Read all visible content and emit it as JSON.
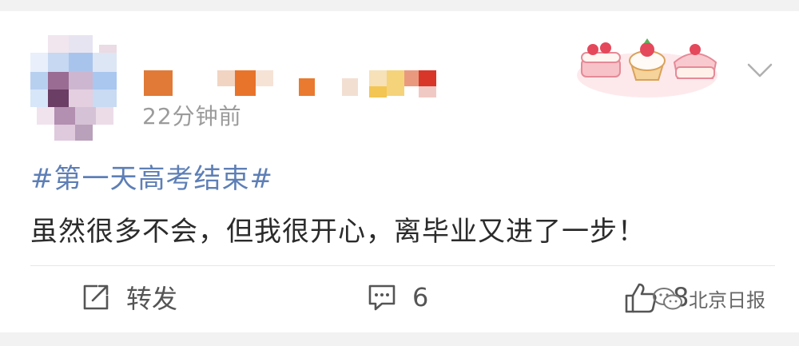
{
  "post": {
    "timestamp": "22分钟前",
    "hashtag": "#第一天高考结束#",
    "text": "虽然很多不会，但我很开心，离毕业又进了一步！"
  },
  "actions": {
    "repost_label": "转发",
    "comment_count": "6",
    "like_count": "8"
  },
  "watermark": {
    "text": "北京日报"
  },
  "icons": {
    "avatar": "avatar-mosaic",
    "badge": "cake-badge-icon",
    "more": "chevron-down-icon",
    "repost": "share-arrow-icon",
    "comment": "comment-icon",
    "like": "thumbs-up-icon",
    "watermark": "wechat-icon"
  },
  "colors": {
    "hashtag": "#5d7fb6",
    "text": "#2b2b2b",
    "meta": "#9b9b9b",
    "background": "#f2f2f2"
  }
}
